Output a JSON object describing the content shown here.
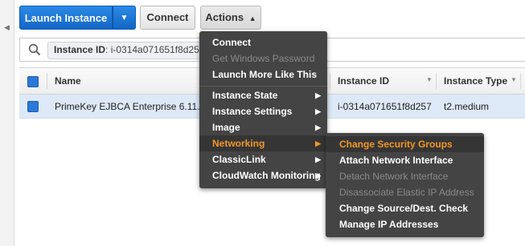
{
  "toolbar": {
    "launch_label": "Launch Instance",
    "connect_label": "Connect",
    "actions_label": "Actions"
  },
  "filter": {
    "token_key": "Instance ID",
    "token_value": ": i-0314a071651f8d257"
  },
  "table": {
    "columns": [
      {
        "label": "Name"
      },
      {
        "label": "Instance ID"
      },
      {
        "label": "Instance Type"
      }
    ],
    "rows": [
      {
        "name": "PrimeKey EJBCA Enterprise 6.11.0",
        "instance_id": "i-0314a071651f8d257",
        "instance_type": "t2.medium",
        "selected": true
      }
    ]
  },
  "actions_menu": {
    "items": [
      {
        "label": "Connect",
        "disabled": false
      },
      {
        "label": "Get Windows Password",
        "disabled": true
      },
      {
        "label": "Launch More Like This",
        "disabled": false
      },
      {
        "label": "Instance State",
        "submenu": true
      },
      {
        "label": "Instance Settings",
        "submenu": true
      },
      {
        "label": "Image",
        "submenu": true
      },
      {
        "label": "Networking",
        "submenu": true,
        "active": true
      },
      {
        "label": "ClassicLink",
        "submenu": true
      },
      {
        "label": "CloudWatch Monitoring",
        "submenu": true
      }
    ]
  },
  "networking_menu": {
    "items": [
      {
        "label": "Change Security Groups",
        "active": true
      },
      {
        "label": "Attach Network Interface",
        "disabled": false
      },
      {
        "label": "Detach Network Interface",
        "disabled": true
      },
      {
        "label": "Disassociate Elastic IP Address",
        "disabled": true
      },
      {
        "label": "Change Source/Dest. Check",
        "disabled": false
      },
      {
        "label": "Manage IP Addresses",
        "disabled": false
      }
    ]
  },
  "colors": {
    "primary_button": "#1a73d9",
    "menu_bg": "#444444",
    "menu_active_text": "#f29727",
    "selected_row": "#dde9f7"
  }
}
